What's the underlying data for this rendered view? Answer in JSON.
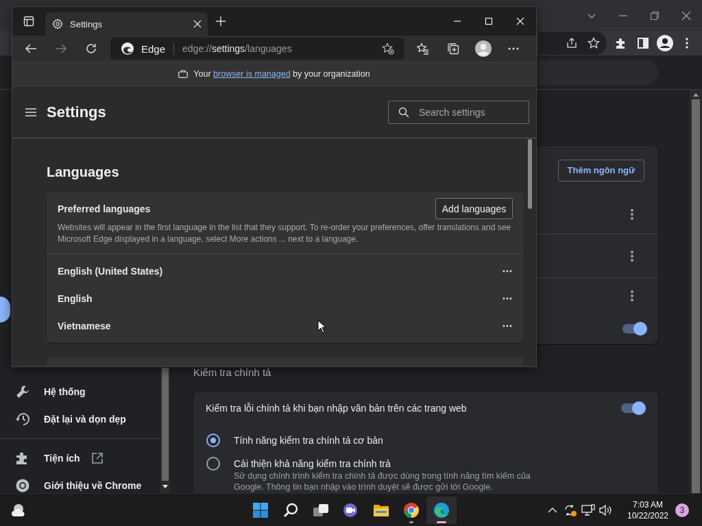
{
  "chrome_window": {
    "sidebar": {
      "items": [
        {
          "label": "Hệ thống",
          "external": false
        },
        {
          "label": "Đặt lại và dọn dẹp",
          "external": false
        },
        {
          "label": "Tiện ích",
          "external": true
        },
        {
          "label": "Giới thiệu về Chrome",
          "external": false
        }
      ]
    },
    "languages_card": {
      "button": "Thêm ngôn ngữ",
      "rows": [
        {
          "kind": "menu"
        },
        {
          "kind": "menu"
        },
        {
          "kind": "menu"
        },
        {
          "kind": "toggle",
          "on": true
        }
      ]
    },
    "spell_check": {
      "heading": "Kiểm tra chính tả",
      "toggle": {
        "label": "Kiểm tra lỗi chính tả khi bạn nhập văn bản trên các trang web",
        "on": true
      },
      "options": [
        {
          "label": "Tính năng kiểm tra chính tả cơ bản",
          "selected": true
        },
        {
          "label": "Cải thiện khả năng kiểm tra chính trả",
          "description": "Sử dụng chính trình kiểm tra chính tả được dùng trong tính năng tìm kiếm của Google. Thông tin bạn nhập vào trình duyệt sẽ được gửi tới Google.",
          "selected": false
        }
      ]
    }
  },
  "edge_window": {
    "tab": {
      "title": "Settings"
    },
    "address_bar": {
      "site": "Edge",
      "url": "edge://**settings**/languages"
    },
    "managed_notice": {
      "before": "Your",
      "link": "browser is managed",
      "after": "by your organization"
    },
    "header": {
      "title": "Settings",
      "search_placeholder": "Search settings"
    },
    "section_title": "Languages",
    "preferred": {
      "title": "Preferred languages",
      "button": "Add languages",
      "description": "Websites will appear in the first language in the list that they support. To re-order your preferences, offer translations and see Microsoft Edge displayed in a language, select More actions ... next to a language.",
      "languages": [
        {
          "name": "English (United States)"
        },
        {
          "name": "English"
        },
        {
          "name": "Vietnamese"
        }
      ]
    }
  },
  "taskbar": {
    "apps": [
      {
        "running": false,
        "selected": false
      },
      {
        "running": false,
        "selected": false
      },
      {
        "running": false,
        "selected": false
      },
      {
        "running": false,
        "selected": false
      },
      {
        "running": false,
        "selected": false
      },
      {
        "running": true,
        "selected": false
      },
      {
        "running": true,
        "selected": true
      }
    ],
    "time": "7:03 AM",
    "date": "10/22/2022",
    "notifications": "3"
  }
}
